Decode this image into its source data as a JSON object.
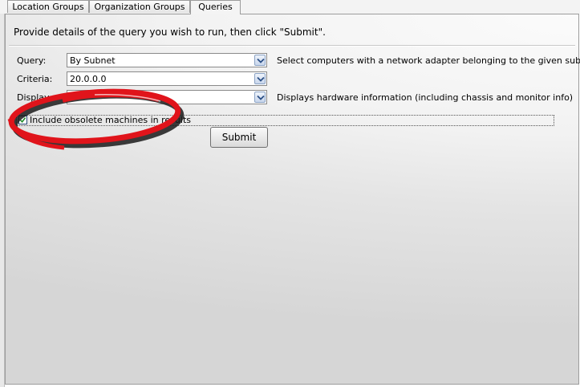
{
  "tabs": [
    {
      "label": "Location Groups",
      "active": false
    },
    {
      "label": "Organization Groups",
      "active": false
    },
    {
      "label": "Queries",
      "active": true
    }
  ],
  "instructions": "Provide details of the query you wish to run, then click \"Submit\".",
  "form": {
    "query": {
      "label": "Query:",
      "value": "By Subnet",
      "description": "Select computers with a network adapter belonging to the given subnet"
    },
    "criteria": {
      "label": "Criteria:",
      "value": "20.0.0.0"
    },
    "display": {
      "label": "Display:",
      "value": "",
      "description": "Displays hardware information (including chassis and monitor info)"
    },
    "include_obsolete": {
      "label": "Include obsolete machines in results",
      "checked": true
    },
    "submit_label": "Submit"
  },
  "annotation": {
    "type": "ellipse-highlight",
    "color": "#e0141b"
  },
  "icons": {
    "dropdown": "chevron-down-icon",
    "checkbox": "checkmark-icon"
  }
}
